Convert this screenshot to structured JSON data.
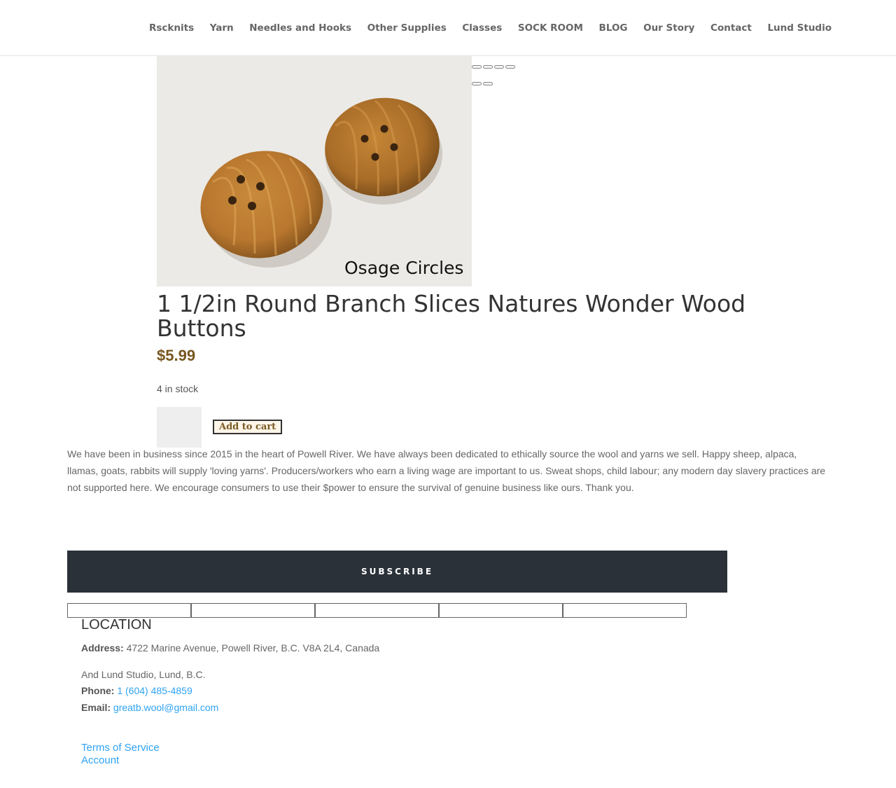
{
  "nav": {
    "items": [
      "Rscknits",
      "Yarn",
      "Needles and Hooks",
      "Other Supplies",
      "Classes",
      "SOCK ROOM",
      "BLOG",
      "Our Story",
      "Contact",
      "Lund Studio"
    ]
  },
  "product": {
    "image_caption": "Osage Circles",
    "title": "1 1/2in Round Branch Slices Natures Wonder Wood Buttons",
    "price": "$5.99",
    "stock": "4 in stock",
    "add_to_cart_label": "Add to cart",
    "quantity": ""
  },
  "about": {
    "text": "We have been in business since 2015 in the heart of Powell River. We have always been dedicated to ethically source the wool and yarns we sell.  Happy sheep, alpaca, llamas, goats, rabbits will supply 'loving yarns'.   Producers/workers who earn a living wage are important to us.  Sweat shops, child labour; any modern day slavery practices are not supported here. We encourage consumers to use their $power to ensure the survival of genuine business like ours.  Thank you."
  },
  "subscribe": {
    "label": "SUBSCRIBE"
  },
  "footer": {
    "location_heading": "LOCATION",
    "address_label": "Address:",
    "address": "4722 Marine Avenue, Powell River, B.C. V8A 2L4, Canada",
    "lund": "And Lund Studio, Lund, B.C.",
    "phone_label": "Phone:",
    "phone": "1 (604) 485-4859",
    "email_label": "Email:",
    "email": "greatb.wool@gmail.com",
    "links": [
      "Terms of Service",
      "Account"
    ]
  },
  "colors": {
    "price": "#77561f",
    "subscribe_bg": "#2a3139",
    "link": "#2ea3f2"
  }
}
